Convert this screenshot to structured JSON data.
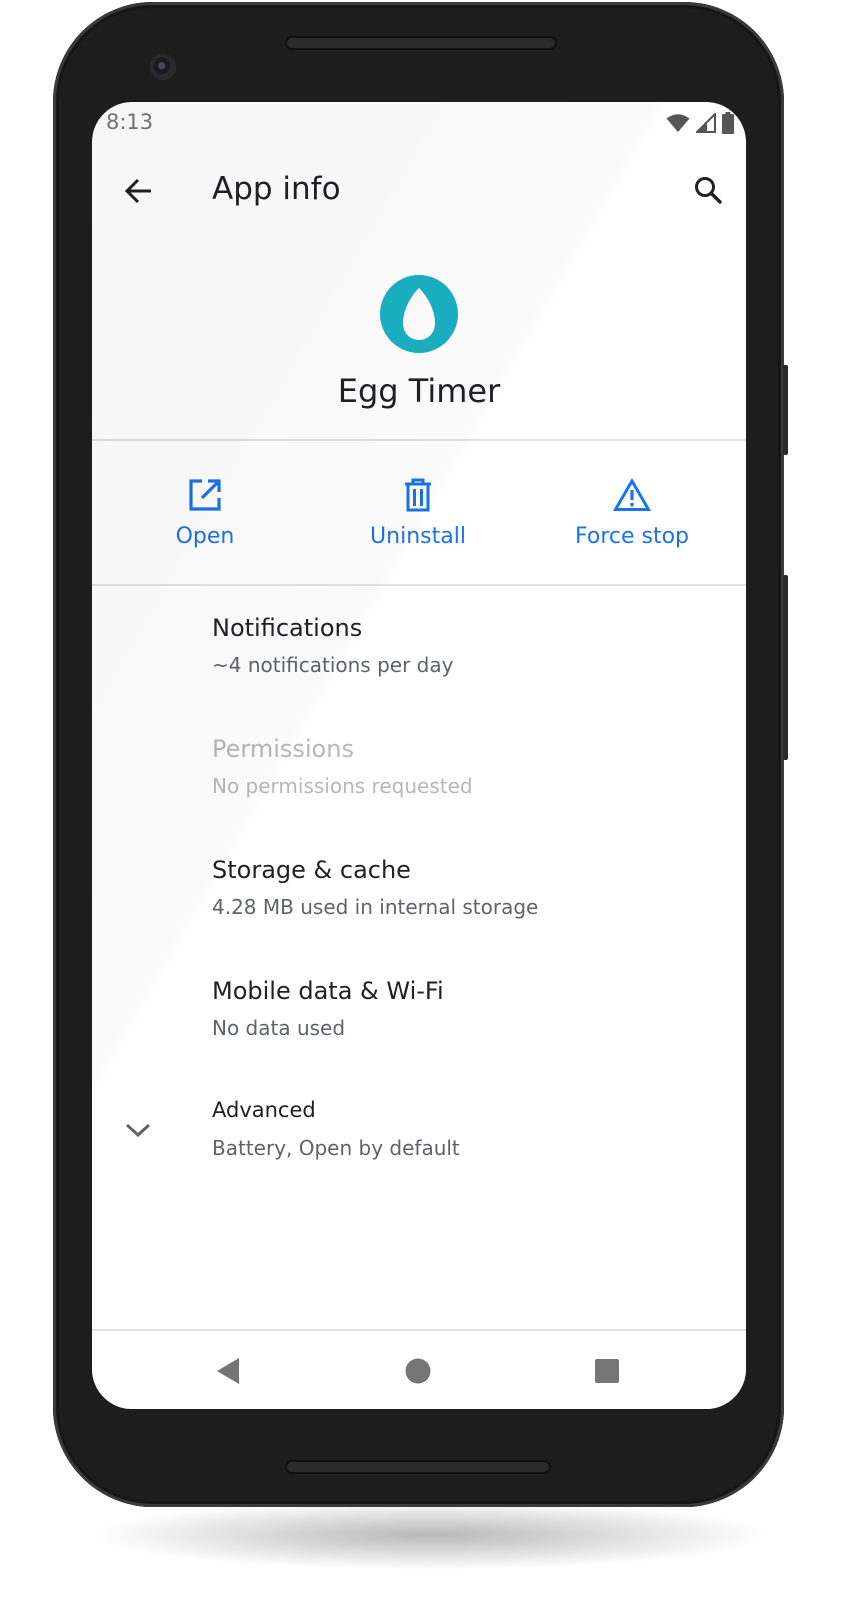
{
  "status_bar": {
    "time": "8:13",
    "icons": [
      "wifi-icon",
      "cell-signal-icon",
      "battery-icon"
    ]
  },
  "app_bar": {
    "title": "App info",
    "back_icon": "arrow-back-icon",
    "search_icon": "search-icon"
  },
  "app": {
    "name": "Egg Timer",
    "icon": "egg-icon",
    "icon_color": "#1bb1c4"
  },
  "actions": [
    {
      "label": "Open",
      "icon": "open-in-new-icon"
    },
    {
      "label": "Uninstall",
      "icon": "trash-icon"
    },
    {
      "label": "Force stop",
      "icon": "warning-triangle-icon"
    }
  ],
  "accent_color": "#1a73e8",
  "settings": [
    {
      "title": "Notifications",
      "subtitle": "~4 notifications per day",
      "enabled": true
    },
    {
      "title": "Permissions",
      "subtitle": "No permissions requested",
      "enabled": false
    },
    {
      "title": "Storage & cache",
      "subtitle": "4.28 MB used in internal storage",
      "enabled": true
    },
    {
      "title": "Mobile data & Wi-Fi",
      "subtitle": "No data used",
      "enabled": true
    },
    {
      "title": "Advanced",
      "subtitle": "Battery, Open by default",
      "enabled": true,
      "icon": "chevron-down-icon"
    }
  ],
  "nav_bar": {
    "icons": [
      "nav-back-icon",
      "nav-home-icon",
      "nav-recents-icon"
    ]
  }
}
